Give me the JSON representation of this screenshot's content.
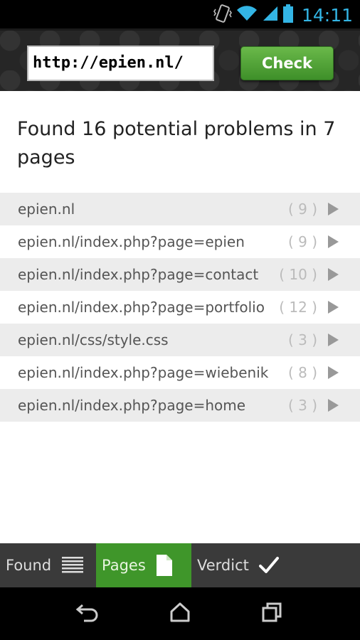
{
  "status": {
    "time": "14:11",
    "accent_color": "#33b5e5",
    "icons": [
      "vibrate-icon",
      "wifi-icon",
      "signal-icon",
      "battery-icon"
    ]
  },
  "header": {
    "url_value": "http://epien.nl/",
    "check_label": "Check",
    "check_color": "#4fa532"
  },
  "main": {
    "summary": "Found 16 potential problems in 7 pages",
    "pages": [
      {
        "url": "epien.nl",
        "count": "( 9 )"
      },
      {
        "url": "epien.nl/index.php?page=epien",
        "count": "( 9 )"
      },
      {
        "url": "epien.nl/index.php?page=contact",
        "count": "( 10 )"
      },
      {
        "url": "epien.nl/index.php?page=portfolio",
        "count": "( 12 )"
      },
      {
        "url": "epien.nl/css/style.css",
        "count": "( 3 )"
      },
      {
        "url": "epien.nl/index.php?page=wiebenik",
        "count": "( 8 )"
      },
      {
        "url": "epien.nl/index.php?page=home",
        "count": "( 3 )"
      }
    ]
  },
  "tabs": [
    {
      "label": "Found",
      "icon": "list-icon",
      "active": false
    },
    {
      "label": "Pages",
      "icon": "page-icon",
      "active": true
    },
    {
      "label": "Verdict",
      "icon": "checkmark-icon",
      "active": false
    }
  ],
  "colors": {
    "active_tab": "#3f962a",
    "tab_bar": "#3a3a3a"
  },
  "navbar": {
    "icons": [
      "back-icon",
      "home-icon",
      "recent-apps-icon"
    ]
  }
}
